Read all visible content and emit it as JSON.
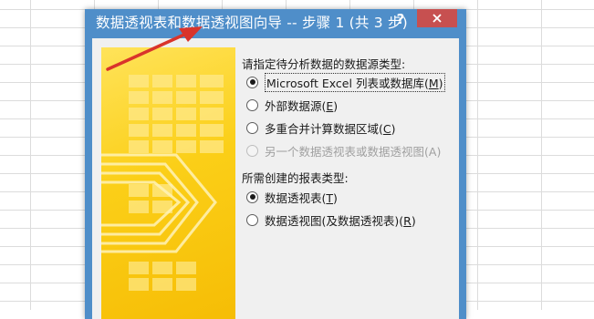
{
  "dialog": {
    "title": "数据透视表和数据透视图向导 -- 步骤 1 (共 3 步)",
    "help_label": "?"
  },
  "source_group": {
    "label": "请指定待分析数据的数据源类型:",
    "options": [
      {
        "pre": "Microsoft Excel 列表或数据库(",
        "key": "M",
        "post": ")",
        "checked": true,
        "enabled": true
      },
      {
        "pre": "外部数据源(",
        "key": "E",
        "post": ")",
        "checked": false,
        "enabled": true
      },
      {
        "pre": "多重合并计算数据区域(",
        "key": "C",
        "post": ")",
        "checked": false,
        "enabled": true
      },
      {
        "pre": "另一个数据透视表或数据透视图(",
        "key": "A",
        "post": ")",
        "checked": false,
        "enabled": false
      }
    ]
  },
  "report_group": {
    "label": "所需创建的报表类型:",
    "options": [
      {
        "pre": "数据透视表(",
        "key": "T",
        "post": ")",
        "checked": true,
        "enabled": true
      },
      {
        "pre": "数据透视图(及数据透视表)(",
        "key": "R",
        "post": ")",
        "checked": false,
        "enabled": true
      }
    ]
  },
  "colors": {
    "titlebar": "#4f8ec9",
    "close_button": "#c75050",
    "annotation_arrow": "#d9342b",
    "wizard_graphic": "#fbcf18"
  }
}
